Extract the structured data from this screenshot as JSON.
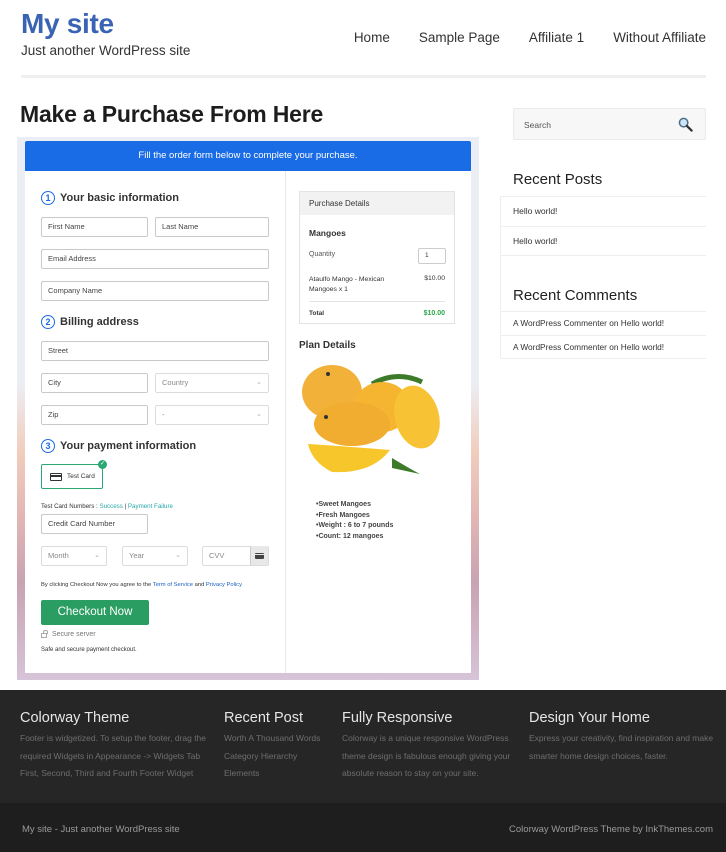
{
  "header": {
    "site_title": "My site",
    "tagline": "Just another WordPress site",
    "nav": [
      "Home",
      "Sample Page",
      "Affiliate 1",
      "Without Affiliate"
    ]
  },
  "page_title": "Make a Purchase From Here",
  "form": {
    "banner": "Fill the order form below to complete your purchase.",
    "step1": {
      "num": "1",
      "label": "Your basic information"
    },
    "first_name": "First Name",
    "last_name": "Last Name",
    "email": "Email Address",
    "company": "Company Name",
    "step2": {
      "num": "2",
      "label": "Billing address"
    },
    "street": "Street",
    "city": "City",
    "country": "Country",
    "zip": "Zip",
    "state": "-",
    "step3": {
      "num": "3",
      "label": "Your payment information"
    },
    "test_card": "Test Card",
    "test_card_numbers": "Test Card Numbers : ",
    "success": "Success",
    "separator": " | ",
    "payment_failure": "Payment Failure",
    "card_number": "Credit Card Number",
    "month": "Month",
    "year": "Year",
    "cvv": "CVV",
    "terms_prefix": "By clicking Checkout Now you agree to the ",
    "terms_link": "Term of Service",
    "terms_and": " and ",
    "privacy_link": "Privacy Policy",
    "checkout": "Checkout Now",
    "secure": "Secure server",
    "safe": "Safe and secure payment checkout."
  },
  "purchase": {
    "header": "Purchase Details",
    "product": "Mangoes",
    "quantity_label": "Quantity",
    "quantity": "1",
    "item": "Ataulfo Mango - Mexican Mangoes x 1",
    "item_price": "$10.00",
    "total_label": "Total",
    "total": "$10.00",
    "total_color": "#2aa84a"
  },
  "plan": {
    "title": "Plan Details",
    "features": [
      "Sweet Mangoes",
      "Fresh Mangoes",
      "Weight : 6 to 7 pounds",
      "Count: 12 mangoes"
    ]
  },
  "sidebar": {
    "search_placeholder": "Search",
    "recent_posts_title": "Recent Posts",
    "recent_posts": [
      "Hello world!",
      "Hello world!"
    ],
    "recent_comments_title": "Recent Comments",
    "recent_comments": [
      "A WordPress Commenter on Hello world!",
      "A WordPress Commenter on Hello world!"
    ]
  },
  "footer": {
    "cols": [
      {
        "title": "Colorway Theme",
        "text": "Footer is widgetized. To setup the footer, drag the required Widgets in Appearance -> Widgets Tab First, Second, Third and Fourth Footer Widget"
      },
      {
        "title": "Recent Post",
        "links": [
          "Worth A Thousand Words",
          "Category Hierarchy",
          "Elements"
        ]
      },
      {
        "title": "Fully Responsive",
        "text": "Colorway is a unique responsive WordPress theme design is fabulous enough giving your absolute reason to stay on your site."
      },
      {
        "title": "Design Your Home",
        "text": "Express your creativity, find inspiration and make smarter home design choices, faster."
      }
    ],
    "bottom_left": "My site - Just another WordPress site",
    "bottom_right": "Colorway WordPress Theme by InkThemes.com"
  },
  "colors": {
    "brand_blue": "#3a63b4",
    "banner_blue": "#1a6be6",
    "checkout_green": "#2a9d62"
  }
}
